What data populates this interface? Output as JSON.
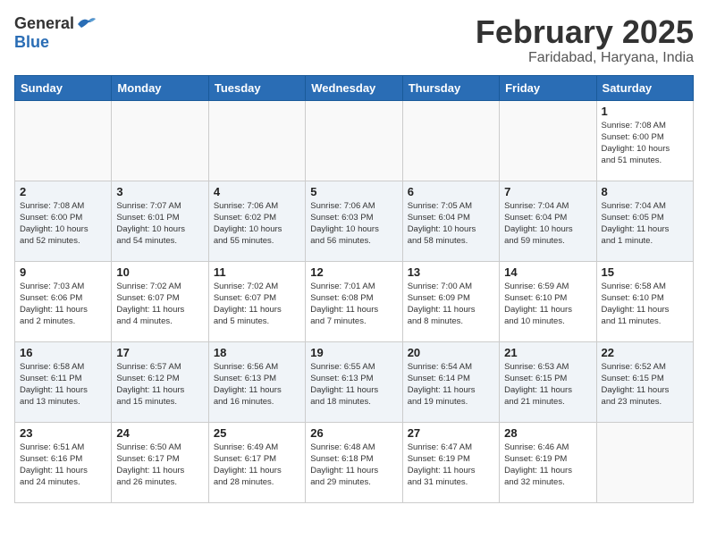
{
  "logo": {
    "general": "General",
    "blue": "Blue"
  },
  "title": {
    "month_year": "February 2025",
    "location": "Faridabad, Haryana, India"
  },
  "headers": [
    "Sunday",
    "Monday",
    "Tuesday",
    "Wednesday",
    "Thursday",
    "Friday",
    "Saturday"
  ],
  "weeks": [
    [
      {
        "day": "",
        "info": ""
      },
      {
        "day": "",
        "info": ""
      },
      {
        "day": "",
        "info": ""
      },
      {
        "day": "",
        "info": ""
      },
      {
        "day": "",
        "info": ""
      },
      {
        "day": "",
        "info": ""
      },
      {
        "day": "1",
        "info": "Sunrise: 7:08 AM\nSunset: 6:00 PM\nDaylight: 10 hours\nand 51 minutes."
      }
    ],
    [
      {
        "day": "2",
        "info": "Sunrise: 7:08 AM\nSunset: 6:00 PM\nDaylight: 10 hours\nand 52 minutes."
      },
      {
        "day": "3",
        "info": "Sunrise: 7:07 AM\nSunset: 6:01 PM\nDaylight: 10 hours\nand 54 minutes."
      },
      {
        "day": "4",
        "info": "Sunrise: 7:06 AM\nSunset: 6:02 PM\nDaylight: 10 hours\nand 55 minutes."
      },
      {
        "day": "5",
        "info": "Sunrise: 7:06 AM\nSunset: 6:03 PM\nDaylight: 10 hours\nand 56 minutes."
      },
      {
        "day": "6",
        "info": "Sunrise: 7:05 AM\nSunset: 6:04 PM\nDaylight: 10 hours\nand 58 minutes."
      },
      {
        "day": "7",
        "info": "Sunrise: 7:04 AM\nSunset: 6:04 PM\nDaylight: 10 hours\nand 59 minutes."
      },
      {
        "day": "8",
        "info": "Sunrise: 7:04 AM\nSunset: 6:05 PM\nDaylight: 11 hours\nand 1 minute."
      }
    ],
    [
      {
        "day": "9",
        "info": "Sunrise: 7:03 AM\nSunset: 6:06 PM\nDaylight: 11 hours\nand 2 minutes."
      },
      {
        "day": "10",
        "info": "Sunrise: 7:02 AM\nSunset: 6:07 PM\nDaylight: 11 hours\nand 4 minutes."
      },
      {
        "day": "11",
        "info": "Sunrise: 7:02 AM\nSunset: 6:07 PM\nDaylight: 11 hours\nand 5 minutes."
      },
      {
        "day": "12",
        "info": "Sunrise: 7:01 AM\nSunset: 6:08 PM\nDaylight: 11 hours\nand 7 minutes."
      },
      {
        "day": "13",
        "info": "Sunrise: 7:00 AM\nSunset: 6:09 PM\nDaylight: 11 hours\nand 8 minutes."
      },
      {
        "day": "14",
        "info": "Sunrise: 6:59 AM\nSunset: 6:10 PM\nDaylight: 11 hours\nand 10 minutes."
      },
      {
        "day": "15",
        "info": "Sunrise: 6:58 AM\nSunset: 6:10 PM\nDaylight: 11 hours\nand 11 minutes."
      }
    ],
    [
      {
        "day": "16",
        "info": "Sunrise: 6:58 AM\nSunset: 6:11 PM\nDaylight: 11 hours\nand 13 minutes."
      },
      {
        "day": "17",
        "info": "Sunrise: 6:57 AM\nSunset: 6:12 PM\nDaylight: 11 hours\nand 15 minutes."
      },
      {
        "day": "18",
        "info": "Sunrise: 6:56 AM\nSunset: 6:13 PM\nDaylight: 11 hours\nand 16 minutes."
      },
      {
        "day": "19",
        "info": "Sunrise: 6:55 AM\nSunset: 6:13 PM\nDaylight: 11 hours\nand 18 minutes."
      },
      {
        "day": "20",
        "info": "Sunrise: 6:54 AM\nSunset: 6:14 PM\nDaylight: 11 hours\nand 19 minutes."
      },
      {
        "day": "21",
        "info": "Sunrise: 6:53 AM\nSunset: 6:15 PM\nDaylight: 11 hours\nand 21 minutes."
      },
      {
        "day": "22",
        "info": "Sunrise: 6:52 AM\nSunset: 6:15 PM\nDaylight: 11 hours\nand 23 minutes."
      }
    ],
    [
      {
        "day": "23",
        "info": "Sunrise: 6:51 AM\nSunset: 6:16 PM\nDaylight: 11 hours\nand 24 minutes."
      },
      {
        "day": "24",
        "info": "Sunrise: 6:50 AM\nSunset: 6:17 PM\nDaylight: 11 hours\nand 26 minutes."
      },
      {
        "day": "25",
        "info": "Sunrise: 6:49 AM\nSunset: 6:17 PM\nDaylight: 11 hours\nand 28 minutes."
      },
      {
        "day": "26",
        "info": "Sunrise: 6:48 AM\nSunset: 6:18 PM\nDaylight: 11 hours\nand 29 minutes."
      },
      {
        "day": "27",
        "info": "Sunrise: 6:47 AM\nSunset: 6:19 PM\nDaylight: 11 hours\nand 31 minutes."
      },
      {
        "day": "28",
        "info": "Sunrise: 6:46 AM\nSunset: 6:19 PM\nDaylight: 11 hours\nand 32 minutes."
      },
      {
        "day": "",
        "info": ""
      }
    ]
  ]
}
